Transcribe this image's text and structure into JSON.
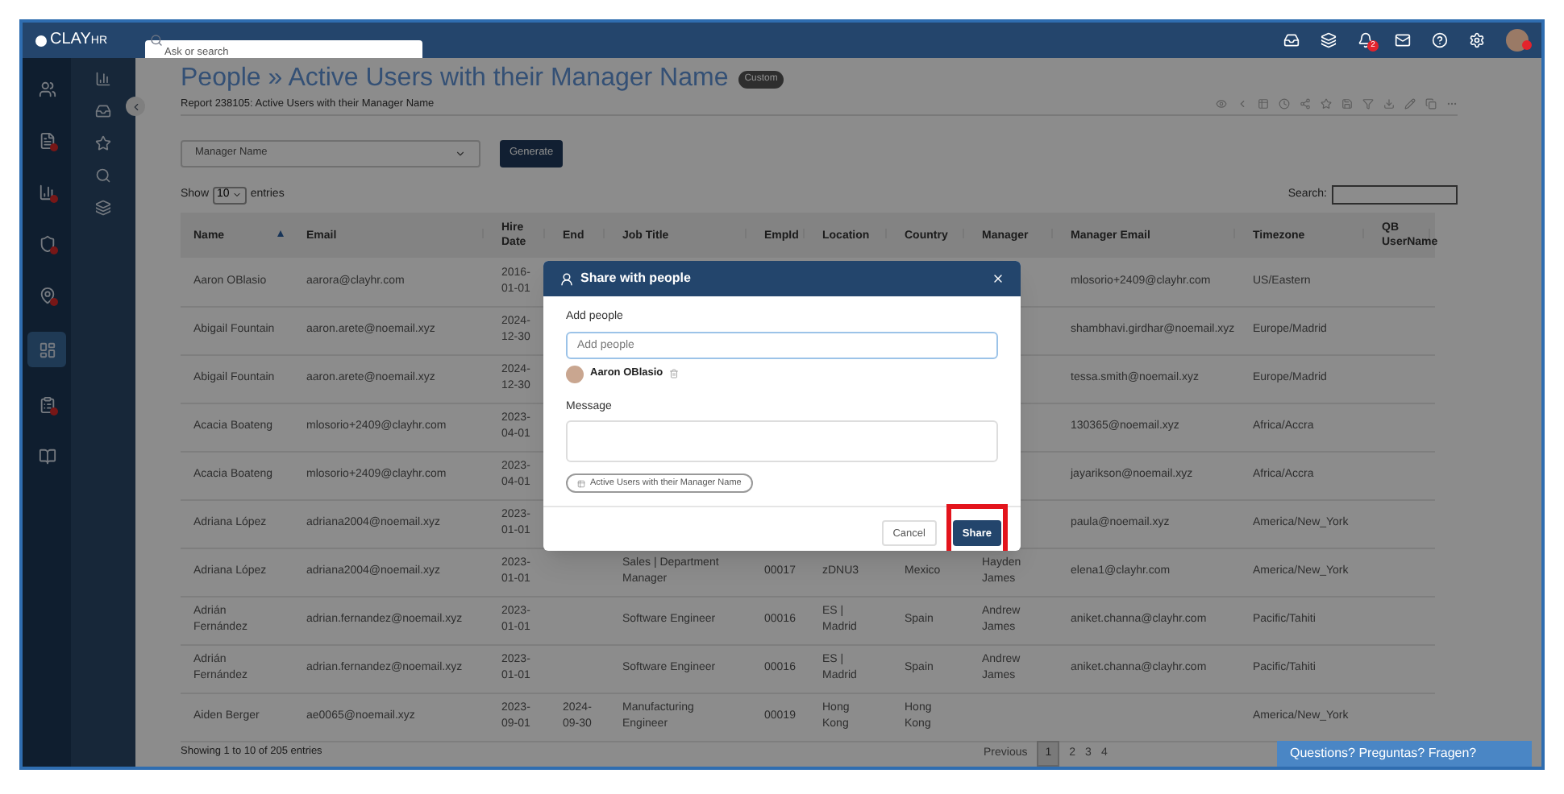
{
  "topbar": {
    "logo": "CLAY",
    "logo_suffix": "HR",
    "search_placeholder": "Ask or search",
    "bell_badge": "2"
  },
  "rail": [
    {
      "badge": false,
      "selected": false
    },
    {
      "badge": true,
      "selected": false
    },
    {
      "badge": true,
      "selected": false
    },
    {
      "badge": true,
      "selected": false
    },
    {
      "badge": true,
      "selected": false
    },
    {
      "badge": false,
      "selected": true
    },
    {
      "badge": true,
      "selected": false
    },
    {
      "badge": false,
      "selected": false
    }
  ],
  "page": {
    "title": "People » Active Users with their Manager Name",
    "tag": "Custom",
    "subtitle": "Report 238105: Active Users with their Manager Name"
  },
  "filter": {
    "value": "Manager Name",
    "button": "Generate"
  },
  "length": {
    "before": "Show",
    "value": "10",
    "after": "entries"
  },
  "search": {
    "label": "Search:"
  },
  "table": {
    "columns": [
      {
        "label": "Name",
        "sorted": true
      },
      {
        "label": "Email",
        "sorted": false
      },
      {
        "label": "Hire Date",
        "sorted": false
      },
      {
        "label": "End",
        "sorted": false
      },
      {
        "label": "Job Title",
        "sorted": false
      },
      {
        "label": "EmpId",
        "sorted": false
      },
      {
        "label": "Location",
        "sorted": false
      },
      {
        "label": "Country",
        "sorted": false
      },
      {
        "label": "Manager",
        "sorted": false
      },
      {
        "label": "Manager Email",
        "sorted": false
      },
      {
        "label": "Timezone",
        "sorted": false
      },
      {
        "label": "QB UserName",
        "sorted": false
      }
    ],
    "rows": [
      {
        "name": "Aaron OBlasio",
        "email": "aarora@clayhr.com",
        "hire": "2016-01-01",
        "manager_email": "mlosorio+2409@clayhr.com",
        "timezone": "US/Eastern"
      },
      {
        "name": "Abigail Fountain",
        "email": "aaron.arete@noemail.xyz",
        "hire": "2024-12-30",
        "manager_email": "shambhavi.girdhar@noemail.xyz",
        "timezone": "Europe/Madrid"
      },
      {
        "name": "Abigail Fountain",
        "email": "aaron.arete@noemail.xyz",
        "hire": "2024-12-30",
        "manager_email": "tessa.smith@noemail.xyz",
        "timezone": "Europe/Madrid"
      },
      {
        "name": "Acacia Boateng",
        "email": "mlosorio+2409@clayhr.com",
        "hire": "2023-04-01",
        "manager_email": "130365@noemail.xyz",
        "timezone": "Africa/Accra"
      },
      {
        "name": "Acacia Boateng",
        "email": "mlosorio+2409@clayhr.com",
        "hire": "2023-04-01",
        "manager_email": "jayarikson@noemail.xyz",
        "timezone": "Africa/Accra"
      },
      {
        "name": "Adriana López",
        "email": "adriana2004@noemail.xyz",
        "hire": "2023-01-01",
        "manager_email": "paula@noemail.xyz",
        "timezone": "America/New_York"
      },
      {
        "name": "Adriana López",
        "email": "adriana2004@noemail.xyz",
        "hire": "2023-01-01",
        "job": "Sales | Department Manager",
        "empid": "00017",
        "location": "zDNU3",
        "country": "Mexico",
        "manager": "Hayden James",
        "manager_email": "elena1@clayhr.com",
        "timezone": "America/New_York"
      },
      {
        "name": "Adrián Fernández",
        "email": "adrian.fernandez@noemail.xyz",
        "hire": "2023-01-01",
        "job": "Software Engineer",
        "empid": "00016",
        "location": "ES | Madrid",
        "country": "Spain",
        "manager": "Andrew James",
        "manager_email": "aniket.channa@clayhr.com",
        "timezone": "Pacific/Tahiti"
      },
      {
        "name": "Adrián Fernández",
        "email": "adrian.fernandez@noemail.xyz",
        "hire": "2023-01-01",
        "job": "Software Engineer",
        "empid": "00016",
        "location": "ES | Madrid",
        "country": "Spain",
        "manager": "Andrew James",
        "manager_email": "aniket.channa@clayhr.com",
        "timezone": "Pacific/Tahiti"
      },
      {
        "name": "Aiden Berger",
        "email": "ae0065@noemail.xyz",
        "hire": "2023-09-01",
        "end": "2024-09-30",
        "job": "Manufacturing Engineer",
        "empid": "00019",
        "location": "Hong Kong",
        "country": "Hong Kong",
        "timezone": "America/New_York"
      }
    ]
  },
  "footer": {
    "info": "Showing 1 to 10 of 205 entries",
    "pages": [
      {
        "label": "Previous",
        "selected": false
      },
      {
        "label": "1",
        "selected": true
      },
      {
        "label": "2",
        "selected": false
      },
      {
        "label": "3",
        "selected": false
      },
      {
        "label": "4",
        "selected": false
      }
    ]
  },
  "chat": "Questions? Preguntas? Fragen?",
  "modal": {
    "title": "Share with people",
    "add_label": "Add people",
    "add_placeholder": "Add people",
    "people": [
      {
        "name": "Aaron OBlasio"
      }
    ],
    "message_label": "Message",
    "attachment": "Active Users with their Manager Name",
    "buttons": [
      {
        "label": "Cancel",
        "kind": "secondary",
        "highlighted": false
      },
      {
        "label": "Share",
        "kind": "primary",
        "highlighted": true
      }
    ]
  }
}
